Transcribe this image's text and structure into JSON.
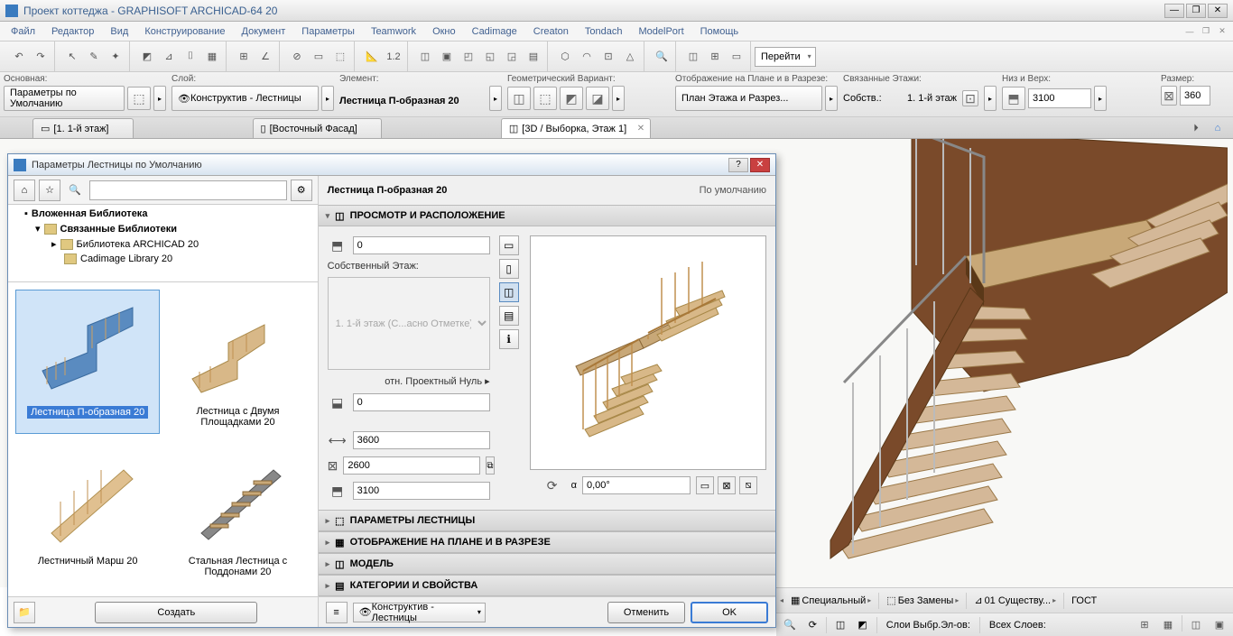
{
  "title": "Проект коттеджа - GRAPHISOFT ARCHICAD-64 20",
  "menu": [
    "Файл",
    "Редактор",
    "Вид",
    "Конструирование",
    "Документ",
    "Параметры",
    "Teamwork",
    "Окно",
    "Cadimage",
    "Creaton",
    "Tondach",
    "ModelPort",
    "Помощь"
  ],
  "goto": "Перейти",
  "infobar": {
    "main_label": "Основная:",
    "main_btn": "Параметры по Умолчанию",
    "layer_label": "Слой:",
    "layer_val": "Конструктив - Лестницы",
    "element_label": "Элемент:",
    "element_val": "Лестница П-образная 20",
    "geom_label": "Геометрический Вариант:",
    "display_label": "Отображение на Плане и в Разрезе:",
    "display_btn": "План Этажа и Разрез...",
    "linked_label": "Связанные Этажи:",
    "linked_sub": "Собств.:",
    "linked_story": "1. 1-й этаж",
    "bottop_label": "Низ и Верх:",
    "bottop_val": "3100",
    "size_label": "Размер:",
    "size_val": "360"
  },
  "tabs": [
    {
      "label": "[1. 1-й этаж]"
    },
    {
      "label": "[Восточный Фасад]"
    },
    {
      "label": "[3D / Выборка, Этаж 1]",
      "active": true,
      "closable": true
    }
  ],
  "dialog": {
    "title": "Параметры Лестницы по Умолчанию",
    "tree": {
      "nested": "Вложенная Библиотека",
      "linked": "Связанные Библиотеки",
      "archlib": "Библиотека ARCHICAD 20",
      "cadimage": "Cadimage Library 20"
    },
    "thumbs": [
      {
        "label": "Лестница П-образная 20",
        "selected": true
      },
      {
        "label": "Лестница с Двумя Площадками 20"
      },
      {
        "label": "Лестничный Марш 20"
      },
      {
        "label": "Стальная Лестница с Поддонами 20"
      }
    ],
    "create": "Создать",
    "right_title": "Лестница П-образная 20",
    "default_text": "По умолчанию",
    "sections": {
      "preview": "ПРОСМОТР И РАСПОЛОЖЕНИЕ",
      "params": "ПАРАМЕТРЫ ЛЕСТНИЦЫ",
      "display": "ОТОБРАЖЕНИЕ НА ПЛАНЕ И В РАЗРЕЗЕ",
      "model": "МОДЕЛЬ",
      "categories": "КАТЕГОРИИ И СВОЙСТВА"
    },
    "params": {
      "elev": "0",
      "own_story": "Собственный Этаж:",
      "story_sel": "1. 1-й этаж (С...асно Отметке)",
      "proj_zero": "отн. Проектный Нуль",
      "proj_zero_val": "0",
      "dim1": "3600",
      "dim2": "2600",
      "dim3": "3100",
      "angle": "0,00°"
    },
    "layer": "Конструктив - Лестницы",
    "cancel": "Отменить",
    "ok": "OK"
  },
  "status": {
    "special": "Специальный",
    "nosub": "Без Замены",
    "exist": "01 Существу...",
    "gost": "ГОСТ",
    "sel_layers": "Слои Выбр.Эл-ов:",
    "all_layers": "Всех Слоев:"
  }
}
